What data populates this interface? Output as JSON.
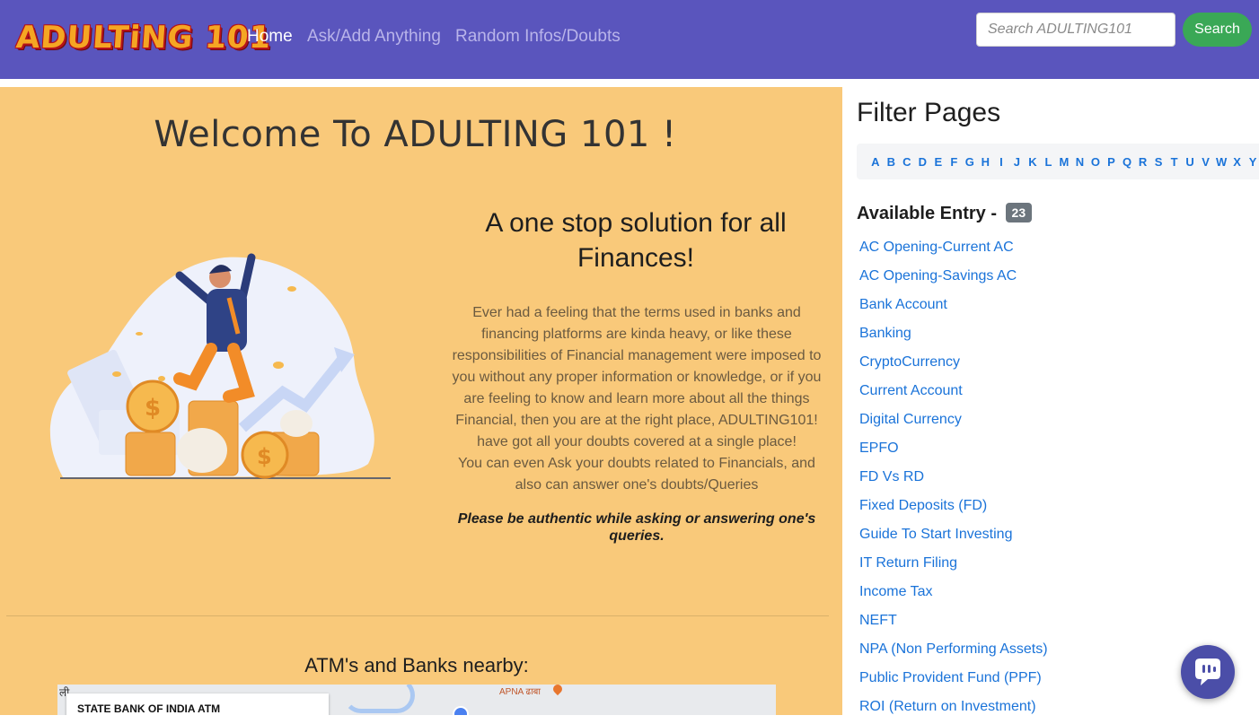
{
  "nav": {
    "logo_text": "ADULTiNG 101",
    "links": [
      "Home",
      "Ask/Add Anything",
      "Random Infos/Doubts"
    ],
    "search_placeholder": "Search ADULTING101",
    "search_button": "Search"
  },
  "main": {
    "welcome": "Welcome To ADULTING 101 !",
    "tagline": "A one stop solution for all Finances!",
    "description_lines": [
      "Ever had a feeling that the terms used in banks and",
      "financing platforms are kinda heavy, or like these",
      "responsibilities of Financial management were imposed to",
      "you without any proper information or knowledge, or if you",
      "are feeling to know and learn more about all the things",
      "Financial, then you are at the right place, ADULTING101!",
      "have got all your doubts covered at a single place!",
      "You can even Ask your doubts related to Financials, and",
      "also can answer one's doubts/Queries"
    ],
    "note": "Please be authentic while asking or answering one's queries.",
    "atm_title": "ATM's and Banks nearby:",
    "map": {
      "card_title": "STATE BANK OF INDIA ATM",
      "place_label": "APNA ढाबा",
      "corner_text": "ली"
    }
  },
  "sidebar": {
    "title": "Filter Pages",
    "alphabet": [
      "A",
      "B",
      "C",
      "D",
      "E",
      "F",
      "G",
      "H",
      "I",
      "J",
      "K",
      "L",
      "M",
      "N",
      "O",
      "P",
      "Q",
      "R",
      "S",
      "T",
      "U",
      "V",
      "W",
      "X",
      "Y"
    ],
    "entry_label": "Available Entry -",
    "entry_count": "23",
    "entries": [
      "AC Opening-Current AC",
      "AC Opening-Savings AC",
      "Bank Account",
      "Banking",
      "CryptoCurrency",
      "Current Account",
      "Digital Currency",
      "EPFO",
      "FD Vs RD",
      "Fixed Deposits (FD)",
      "Guide To Start Investing",
      "IT Return Filing",
      "Income Tax",
      "NEFT",
      "NPA (Non Performing Assets)",
      "Public Provident Fund (PPF)",
      "ROI (Return on Investment)"
    ]
  },
  "colors": {
    "navbar": "#5a55bd",
    "main_bg": "#f9c97a",
    "link": "#1a73d9",
    "search_button": "#3aa856",
    "chat_button": "#4b4ea8"
  },
  "icons": {
    "chat": "chat-bubble-icon",
    "hero": "jumping-man-coins-illustration",
    "map_marker": "map-marker-icon"
  }
}
